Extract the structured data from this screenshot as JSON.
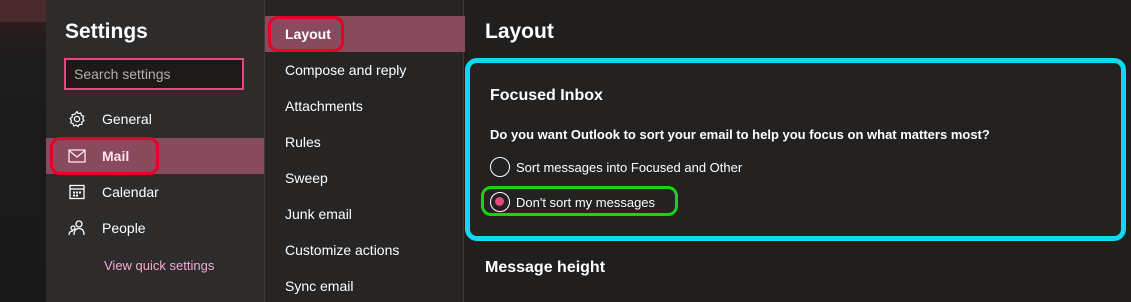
{
  "settings": {
    "title": "Settings",
    "search_placeholder": "Search settings",
    "nav": [
      {
        "label": "General",
        "icon": "gear-icon"
      },
      {
        "label": "Mail",
        "icon": "mail-icon"
      },
      {
        "label": "Calendar",
        "icon": "calendar-icon"
      },
      {
        "label": "People",
        "icon": "people-icon"
      }
    ],
    "selected_nav": "Mail",
    "quick_settings_link": "View quick settings"
  },
  "mail_submenu": {
    "items": [
      "Layout",
      "Compose and reply",
      "Attachments",
      "Rules",
      "Sweep",
      "Junk email",
      "Customize actions",
      "Sync email"
    ],
    "selected": "Layout"
  },
  "main": {
    "title": "Layout",
    "focused_inbox": {
      "title": "Focused Inbox",
      "question": "Do you want Outlook to sort your email to help you focus on what matters most?",
      "options": [
        {
          "label": "Sort messages into Focused and Other",
          "checked": false
        },
        {
          "label": "Don't sort my messages",
          "checked": true
        }
      ]
    },
    "next_section_title": "Message height"
  },
  "colors": {
    "accent_pink": "#e8467f",
    "selected_row": "#8a4a5e",
    "highlight_cyan": "#0fd8f0",
    "highlight_red": "#e60026",
    "highlight_green": "#18d21a"
  }
}
